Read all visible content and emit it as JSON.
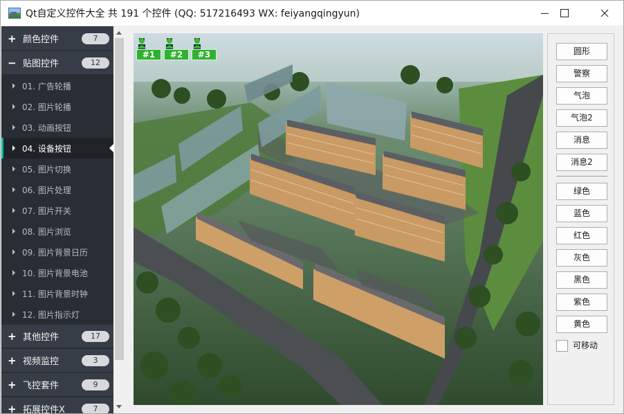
{
  "window": {
    "title": "Qt自定义控件大全 共 191 个控件 (QQ: 517216493 WX: feiyangqingyun)"
  },
  "sidebar": {
    "groups": [
      {
        "sign": "+",
        "label": "颜色控件",
        "count": "7"
      },
      {
        "sign": "−",
        "label": "贴图控件",
        "count": "12"
      },
      {
        "sign": "+",
        "label": "其他控件",
        "count": "17"
      },
      {
        "sign": "+",
        "label": "视频监控",
        "count": "3"
      },
      {
        "sign": "+",
        "label": "飞控套件",
        "count": "9"
      },
      {
        "sign": "+",
        "label": "拓展控件X",
        "count": "7"
      }
    ],
    "items": [
      "01. 广告轮播",
      "02. 图片轮播",
      "03. 动画按钮",
      "04. 设备按钮",
      "05. 图片切换",
      "06. 图片处理",
      "07. 图片开关",
      "08. 图片浏览",
      "09. 图片背景日历",
      "10. 图片背景电池",
      "11. 图片背景时钟",
      "12. 图片指示灯"
    ],
    "active_item": "04. 设备按钮",
    "accent_color": "#00bb9e"
  },
  "devices": [
    {
      "label": "#1",
      "icon1": "police-icon",
      "icon2": "user-icon",
      "color": "#2fb12f"
    },
    {
      "label": "#2",
      "icon1": "police-icon",
      "icon2": "user-icon",
      "color": "#2fb12f"
    },
    {
      "label": "#3",
      "icon1": "police-icon",
      "icon2": "user-icon",
      "color": "#2fb12f"
    }
  ],
  "buttons": {
    "style": [
      "圆形",
      "警察",
      "气泡",
      "气泡2",
      "消息",
      "消息2"
    ],
    "colors": [
      "绿色",
      "蓝色",
      "红色",
      "灰色",
      "黑色",
      "紫色",
      "黄色"
    ]
  },
  "movable": {
    "label": "可移动",
    "checked": false
  }
}
